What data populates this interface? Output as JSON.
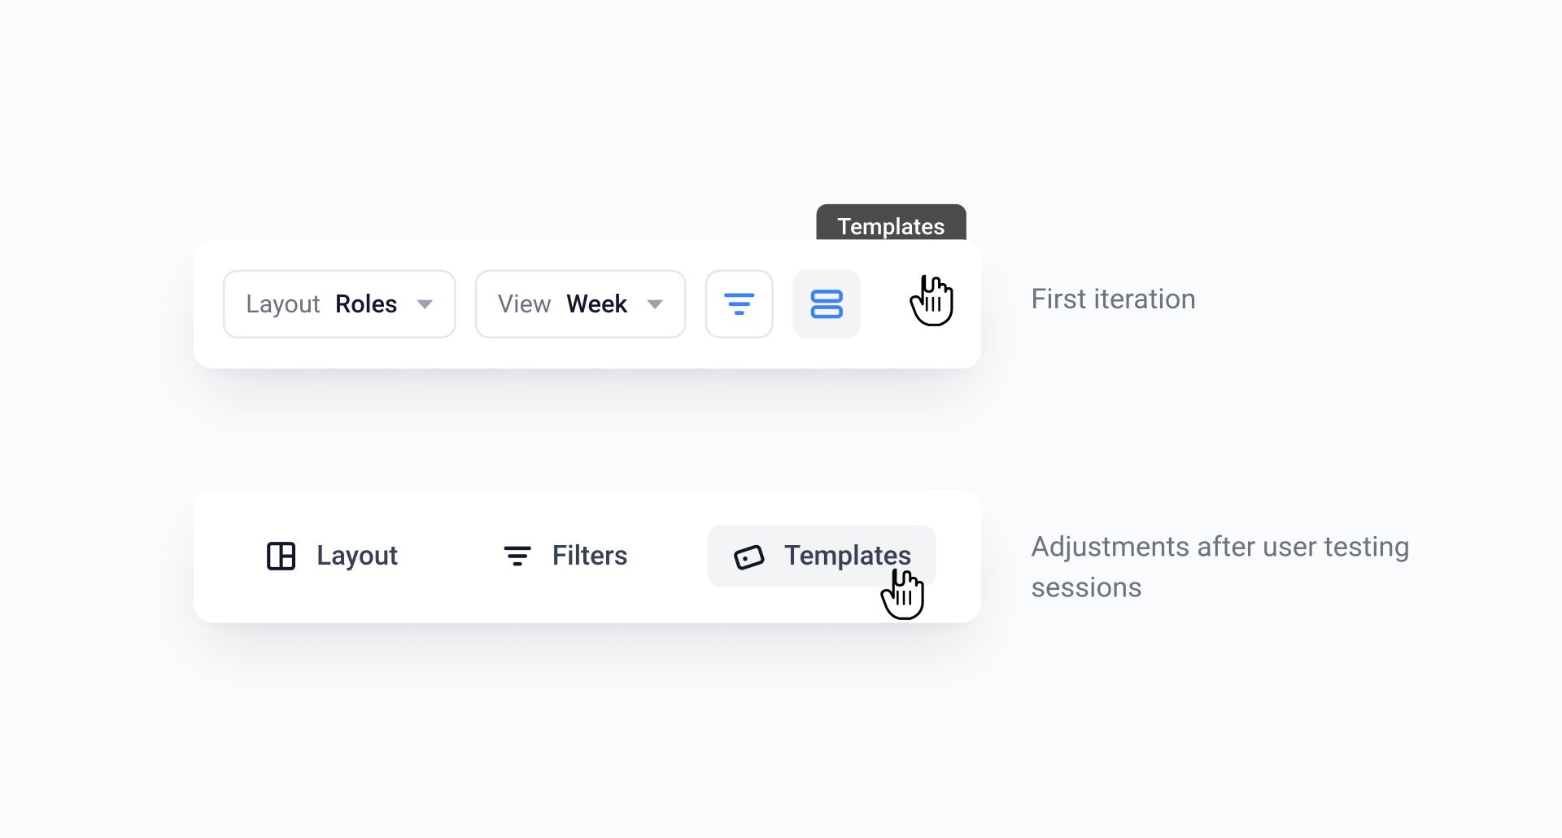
{
  "iteration1": {
    "caption": "First iteration",
    "layout": {
      "label": "Layout",
      "value": "Roles"
    },
    "view": {
      "label": "View",
      "value": "Week"
    },
    "tooltip": "Templates"
  },
  "iteration2": {
    "caption": "Adjustments after user testing sessions",
    "items": {
      "layout": "Layout",
      "filters": "Filters",
      "templates": "Templates"
    }
  },
  "colors": {
    "accent": "#3b82f6",
    "ink": "#111827",
    "muted": "#6b7280"
  }
}
